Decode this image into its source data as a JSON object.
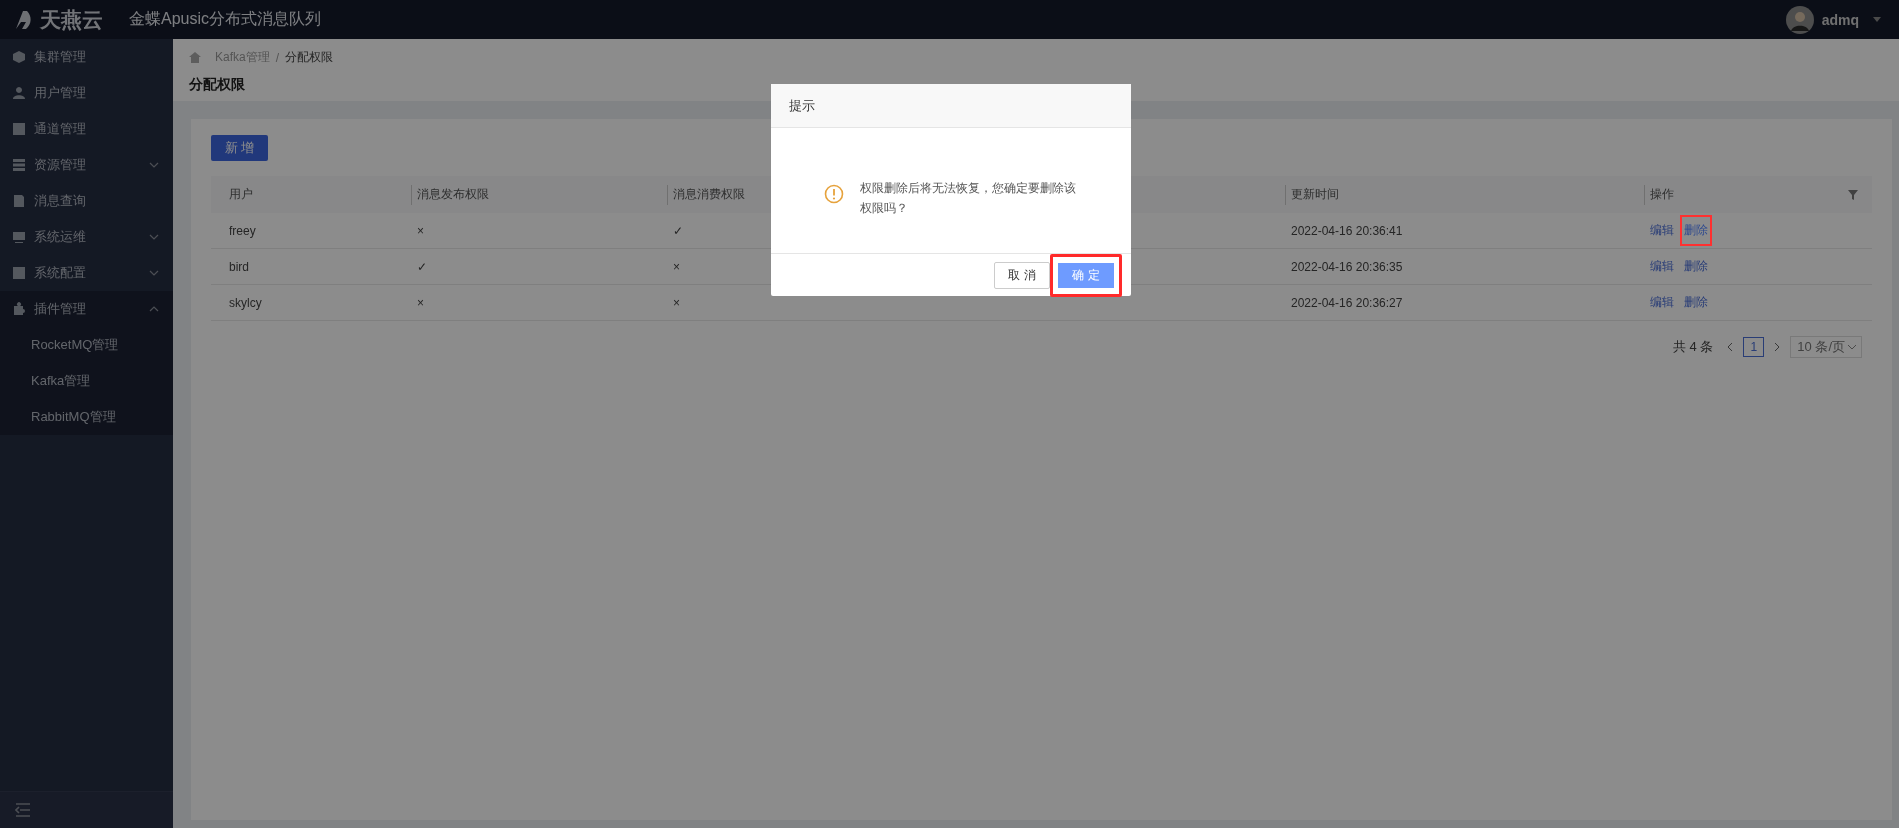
{
  "header": {
    "logo": "天燕云",
    "app_title": "金蝶Apusic分布式消息队列",
    "user": "admq"
  },
  "sidebar": {
    "items": [
      {
        "label": "集群管理"
      },
      {
        "label": "用户管理"
      },
      {
        "label": "通道管理"
      },
      {
        "label": "资源管理",
        "expanded": false
      },
      {
        "label": "消息查询"
      },
      {
        "label": "系统运维",
        "expanded": false
      },
      {
        "label": "系统配置",
        "expanded": false
      },
      {
        "label": "插件管理",
        "expanded": true,
        "children": [
          {
            "label": "RocketMQ管理"
          },
          {
            "label": "Kafka管理"
          },
          {
            "label": "RabbitMQ管理"
          }
        ]
      }
    ]
  },
  "breadcrumb": {
    "separator": "/",
    "items": [
      "Kafka管理",
      "分配权限"
    ]
  },
  "page_title": "分配权限",
  "add_button": "新 增",
  "table": {
    "columns": [
      "用户",
      "消息发布权限",
      "消息消费权限",
      "更新时间",
      "操作"
    ],
    "rows": [
      {
        "cells": [
          "freey",
          "×",
          "✓",
          "2022-04-16 20:36:41"
        ],
        "actions": [
          {
            "label": "编辑",
            "highlighted": false
          },
          {
            "label": "删除",
            "highlighted": true
          }
        ]
      },
      {
        "cells": [
          "bird",
          "✓",
          "×",
          "2022-04-16 20:36:35"
        ],
        "actions": [
          {
            "label": "编辑",
            "highlighted": false
          },
          {
            "label": "删除",
            "highlighted": false
          }
        ]
      },
      {
        "cells": [
          "skylcy",
          "×",
          "×",
          "2022-04-16 20:36:27"
        ],
        "actions": [
          {
            "label": "编辑",
            "highlighted": false
          },
          {
            "label": "删除",
            "highlighted": false
          }
        ]
      }
    ]
  },
  "pagination": {
    "total": "共 4 条",
    "pages": [
      {
        "label": "1",
        "selected": true
      }
    ],
    "page_size": "10 条/页"
  },
  "dialog": {
    "title": "提示",
    "message": "权限删除后将无法恢复，您确定要删除该权限吗？",
    "buttons": [
      {
        "label": "取 消",
        "kind": "default",
        "highlighted": false
      },
      {
        "label": "确 定",
        "kind": "primary",
        "highlighted": true
      }
    ]
  }
}
